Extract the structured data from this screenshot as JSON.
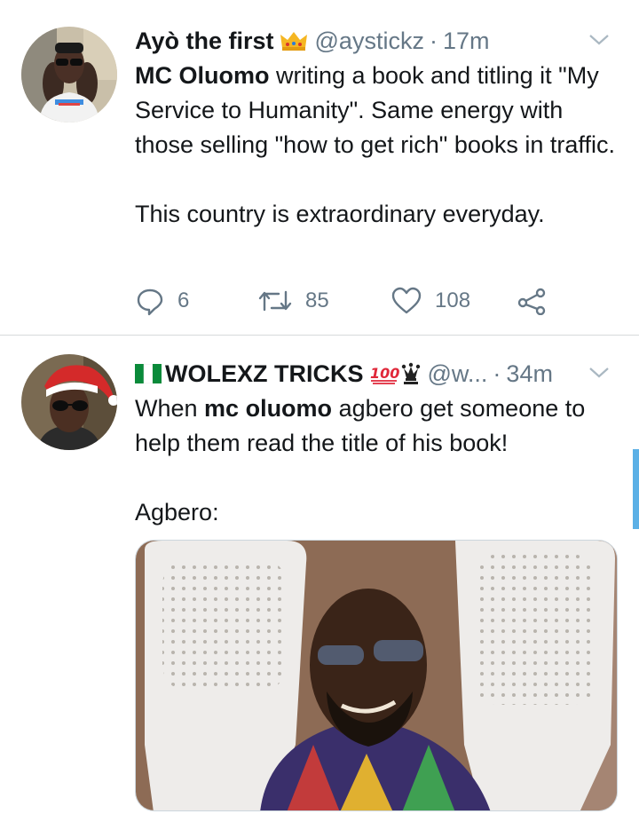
{
  "tweets": [
    {
      "author": {
        "name": "Ayò the first",
        "name_emoji": "crown-icon",
        "handle": "@aystickz"
      },
      "time": "17m",
      "text": {
        "p1_bold": "MC Oluomo",
        "p1_rest": " writing a book and titling it \"My Service to Humanity\". Same energy with those selling \"how to get rich\" books in traffic.",
        "p2": "This country is extraordinary everyday."
      },
      "stats": {
        "replies": "6",
        "retweets": "85",
        "likes": "108"
      }
    },
    {
      "author": {
        "name": "WOLEXZ TRICKS",
        "name_prefix_emoji": "nigeria-flag-icon",
        "name_suffix_emojis": [
          "hundred-points-icon",
          "chess-queen-icon"
        ],
        "handle": "@w..."
      },
      "time": "34m",
      "text": {
        "p1_pre": "When ",
        "p1_bold": "mc oluomo",
        "p1_rest": " agbero get someone to help them read the title of his book!",
        "p2": "Agbero:"
      },
      "media": "photo-man-sunglasses-white-chairs"
    }
  ],
  "colors": {
    "secondary_text": "#657786",
    "divider": "#d6d9db",
    "scrollbar": "#5bb0e6"
  }
}
